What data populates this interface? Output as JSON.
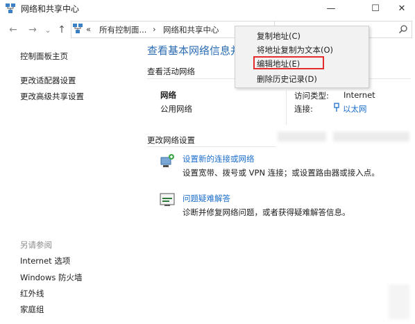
{
  "window": {
    "title": "网络和共享中心",
    "icon": "network-center-icon",
    "minimize": "—",
    "maximize": "☐",
    "close": "✕"
  },
  "address_bar": {
    "back": "←",
    "forward": "→",
    "recent": "⌄",
    "up": "↑",
    "overflow": "«",
    "crumbs": [
      "所有控制面...",
      "网络和共享中心"
    ],
    "separator": "›",
    "dropdown": "⌄",
    "search_icon": "search-icon"
  },
  "context_menu": {
    "items": [
      "复制地址(C)",
      "将地址复制为文本(O)",
      "编辑地址(E)",
      "删除历史记录(D)"
    ],
    "highlighted_index": 2
  },
  "sidebar": {
    "home": "控制面板主页",
    "links": [
      "更改适配器设置",
      "更改高级共享设置"
    ],
    "see_also_title": "另请参阅",
    "see_also": [
      "Internet 选项",
      "Windows 防火墙",
      "红外线",
      "家庭组"
    ]
  },
  "main": {
    "title": "查看基本网络信息并",
    "active_networks_title": "查看活动网络",
    "network_name": "网络",
    "network_type": "公用网络",
    "access_type_label": "访问类型:",
    "access_type_value": "Internet",
    "connection_label": "连接:",
    "connection_value": "以太网",
    "change_settings_title": "更改网络设置",
    "tasks": [
      {
        "link": "设置新的连接或网络",
        "desc": "设置宽带、拨号或 VPN 连接；或设置路由器或接入点。",
        "icon": "new-connection-icon"
      },
      {
        "link": "问题疑难解答",
        "desc": "诊断并修复网络问题，或者获得疑难解答信息。",
        "icon": "troubleshoot-icon"
      }
    ]
  },
  "colors": {
    "link": "#1a6dcc",
    "title": "#2b6cb3",
    "highlight_border": "#e02c2c",
    "menu_bg": "#f2f2f2"
  }
}
